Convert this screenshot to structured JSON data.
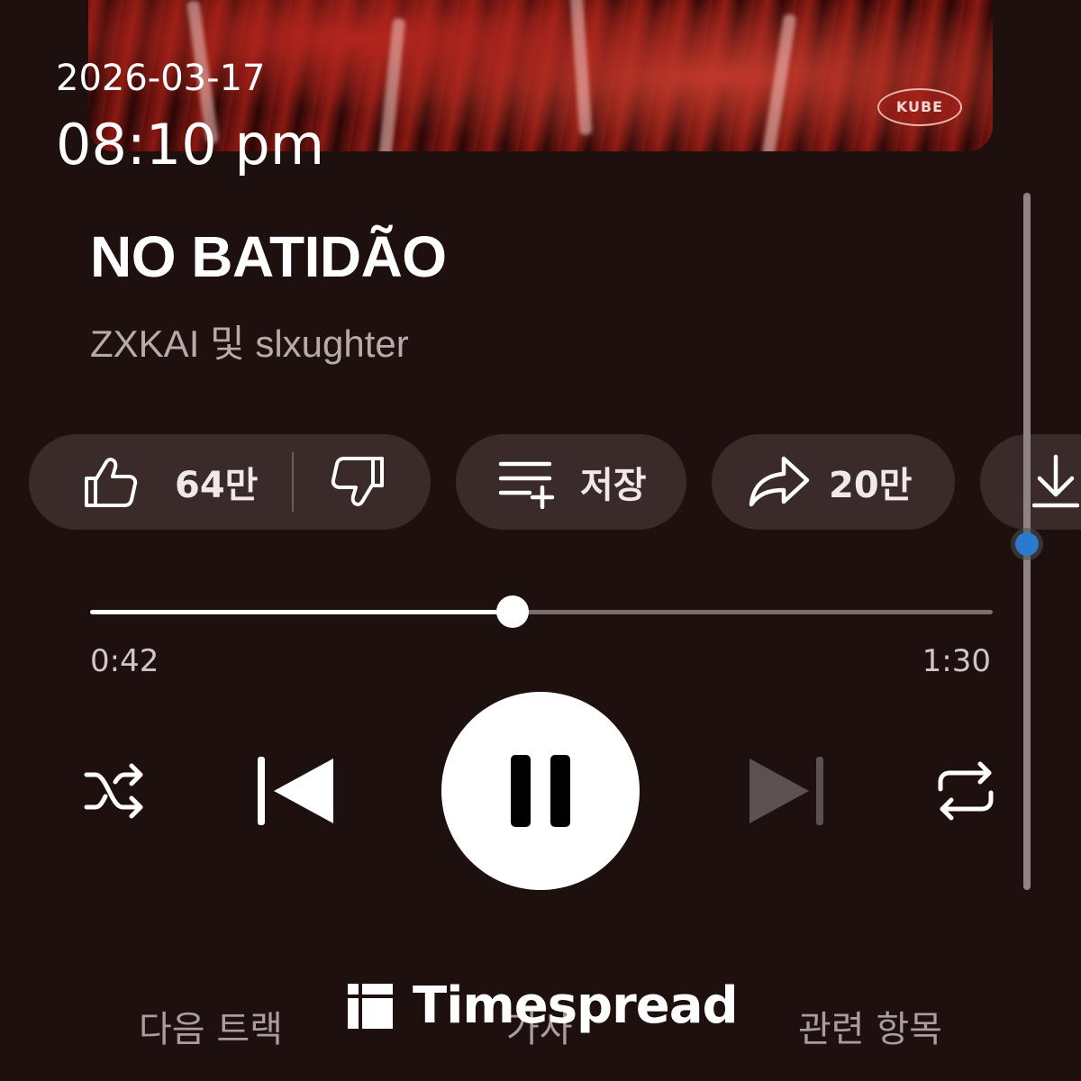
{
  "status_bar": {
    "date": "2026-03-17",
    "time": "08:10 pm"
  },
  "album": {
    "badge_text": "KUBE"
  },
  "song": {
    "title": "NO BATIDÃO",
    "artist": "ZXKAI 및 slxughter"
  },
  "actions": {
    "like_count": "64만",
    "save_label": "저장",
    "share_count": "20만",
    "icons": [
      "thumbs-up-icon",
      "thumbs-down-icon",
      "playlist-add-icon",
      "share-icon",
      "download-icon"
    ]
  },
  "playback": {
    "elapsed": "0:42",
    "total": "1:30",
    "progress_fraction": 0.468
  },
  "controls": [
    "shuffle-icon",
    "previous-icon",
    "pause-icon",
    "next-icon",
    "repeat-icon"
  ],
  "bottom_tabs": [
    "다음 트랙",
    "가사",
    "관련 항목"
  ],
  "watermark": {
    "text": "Timespread"
  },
  "colors": {
    "background": "#1f1010",
    "chip": "#3a2a29",
    "accent_blue": "#2a7ad1"
  }
}
